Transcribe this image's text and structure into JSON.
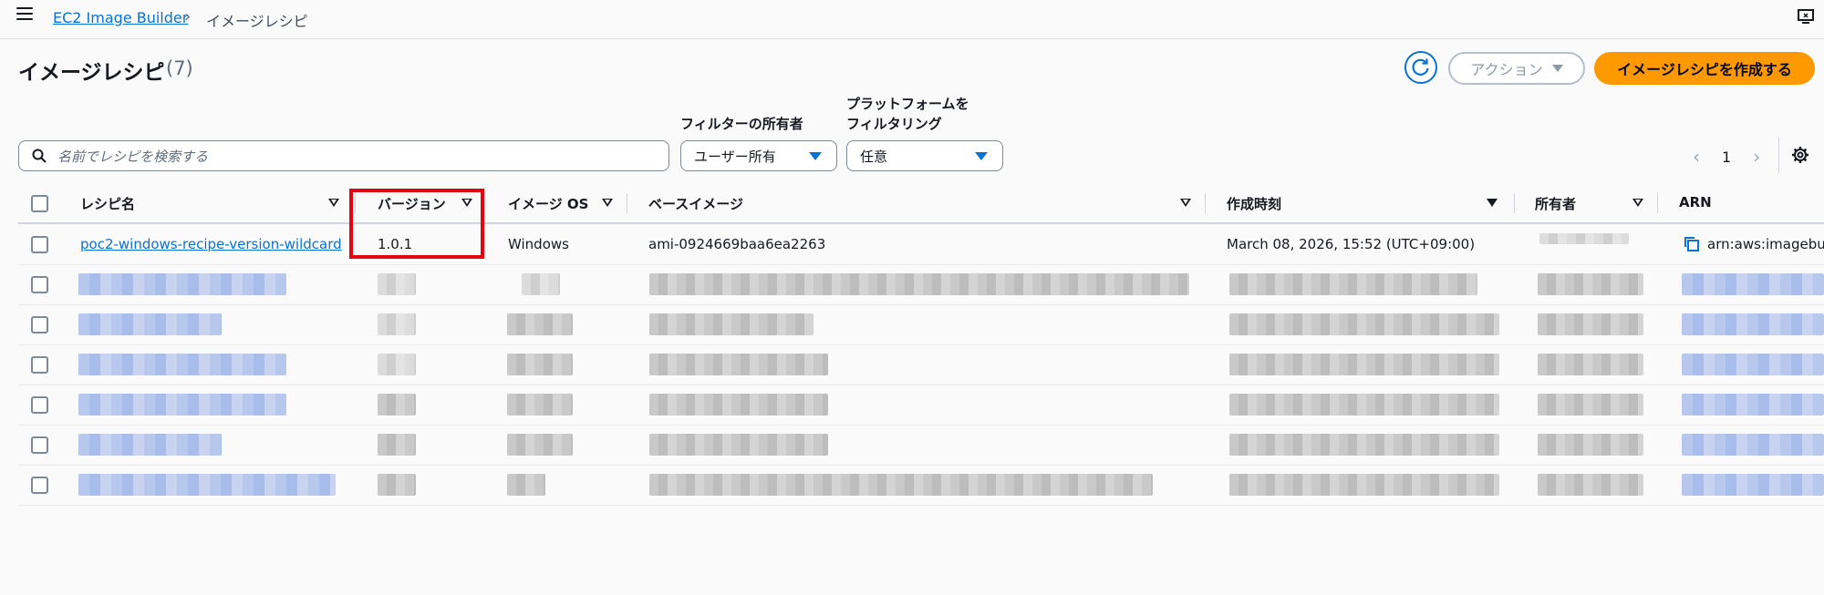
{
  "breadcrumb": {
    "service": "EC2 Image Builder",
    "separator": "›",
    "current": "イメージレシピ"
  },
  "header": {
    "title": "イメージレシピ",
    "count": "(7)",
    "actions_label": "アクション",
    "create_label": "イメージレシピを作成する"
  },
  "filters": {
    "search_placeholder": "名前でレシピを検索する",
    "owner_label": "フィルターの所有者",
    "owner_value": "ユーザー所有",
    "platform_label_line1": "プラットフォームを",
    "platform_label_line2": "フィルタリング",
    "platform_value": "任意"
  },
  "pagination": {
    "prev": "‹",
    "page": "1",
    "next": "›"
  },
  "table": {
    "columns": {
      "name": "レシピ名",
      "version": "バージョン",
      "os": "イメージ OS",
      "base_image": "ベースイメージ",
      "created": "作成時刻",
      "owner": "所有者",
      "arn": "ARN"
    },
    "first_row": {
      "name": "poc2-windows-recipe-version-wildcard",
      "version": "1.0.1",
      "os": "Windows",
      "base_image": "ami-0924669baa6ea2263",
      "created": "March 08, 2026, 15:52 (UTC+09:00)",
      "arn": "arn:aws:imagebu"
    }
  },
  "colors": {
    "accent": "#0972d3",
    "primary_button": "#ff9900",
    "highlight": "#e4040f"
  }
}
